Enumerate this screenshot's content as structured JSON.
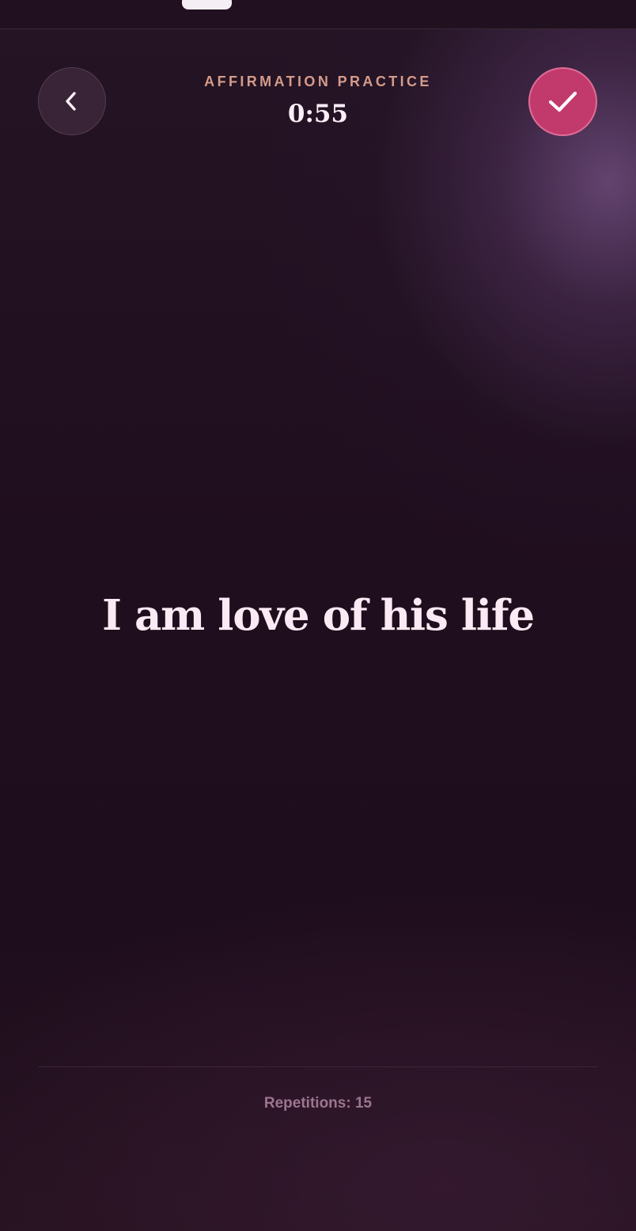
{
  "header": {
    "label": "AFFIRMATION PRACTICE",
    "timer": "0:55",
    "back_icon": "chevron-left-icon",
    "done_icon": "checkmark-icon"
  },
  "affirmation": {
    "text": "I am love of his life"
  },
  "footer": {
    "repetitions": "Repetitions: 15"
  },
  "colors": {
    "accent": "#c23a6c",
    "label": "#d49b8a",
    "background": "#1f0e1e"
  }
}
